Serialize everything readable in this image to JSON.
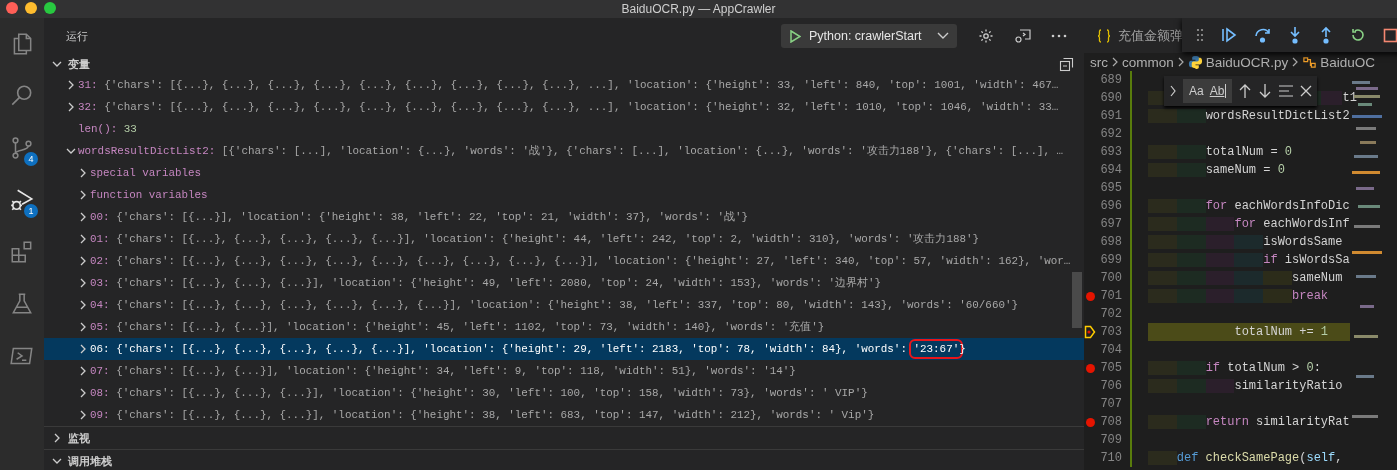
{
  "window": {
    "title": "BaiduOCR.py — AppCrawler"
  },
  "activity_bar": [
    {
      "kind": "files",
      "selected": false
    },
    {
      "kind": "search",
      "selected": false
    },
    {
      "kind": "scm",
      "selected": false,
      "badge": "4"
    },
    {
      "kind": "debug",
      "selected": true,
      "badge": "1"
    },
    {
      "kind": "extensions",
      "selected": false
    },
    {
      "kind": "testing",
      "selected": false
    },
    {
      "kind": "terminal",
      "selected": false
    }
  ],
  "run_panel": {
    "title": "运行",
    "config": "Python: crawlerStart"
  },
  "variables": {
    "title": "变量",
    "expanded": true,
    "nodes": [
      {
        "children": [
          {
            "kind": "item",
            "key": "31:",
            "expanded": false,
            "selected": false,
            "value": "{'chars': [{...}, {...}, {...}, {...}, {...}, {...}, {...}, {...}, {...}, ...], 'location': {'height': 33, 'left': 840, 'top': 1001, 'width': 467…"
          },
          {
            "kind": "item",
            "key": "32:",
            "expanded": false,
            "selected": false,
            "value": "{'chars': [{...}, {...}, {...}, {...}, {...}, {...}, {...}, {...}, {...}, ...], 'location': {'height': 32, 'left': 1010, 'top': 1046, 'width': 33…"
          },
          {
            "kind": "len",
            "key": "len():",
            "selected": false,
            "value": "33"
          }
        ]
      },
      {
        "kind": "item",
        "key": "wordsResultDictList2:",
        "expanded": true,
        "selected": false,
        "value": "[{'chars': [...], 'location': {...}, 'words': '战'}, {'chars': [...], 'location': {...}, 'words': '攻击力188'}, {'chars': [...], …",
        "children": [
          {
            "kind": "group",
            "key": "special variables",
            "expanded": false,
            "selected": false
          },
          {
            "kind": "group",
            "key": "function variables",
            "expanded": false,
            "selected": false
          },
          {
            "kind": "item",
            "key": "00:",
            "expanded": false,
            "selected": false,
            "value": "{'chars': [{...}], 'location': {'height': 38, 'left': 22, 'top': 21, 'width': 37}, 'words': '战'}"
          },
          {
            "kind": "item",
            "key": "01:",
            "expanded": false,
            "selected": false,
            "value": "{'chars': [{...}, {...}, {...}, {...}, {...}], 'location': {'height': 44, 'left': 242, 'top': 2, 'width': 310}, 'words': '攻击力188'}"
          },
          {
            "kind": "item",
            "key": "02:",
            "expanded": false,
            "selected": false,
            "value": "{'chars': [{...}, {...}, {...}, {...}, {...}, {...}, {...}, {...}, {...}], 'location': {'height': 27, 'left': 340, 'top': 57, 'width': 162}, 'wor…"
          },
          {
            "kind": "item",
            "key": "03:",
            "expanded": false,
            "selected": false,
            "value": "{'chars': [{...}, {...}, {...}], 'location': {'height': 49, 'left': 2080, 'top': 24, 'width': 153}, 'words': '边界村'}"
          },
          {
            "kind": "item",
            "key": "04:",
            "expanded": false,
            "selected": false,
            "value": "{'chars': [{...}, {...}, {...}, {...}, {...}, {...}], 'location': {'height': 38, 'left': 337, 'top': 80, 'width': 143}, 'words': '60/660'}"
          },
          {
            "kind": "item",
            "key": "05:",
            "expanded": false,
            "selected": false,
            "value": "{'chars': [{...}, {...}], 'location': {'height': 45, 'left': 1102, 'top': 73, 'width': 140}, 'words': '充值'}"
          },
          {
            "kind": "item",
            "key": "06:",
            "expanded": false,
            "selected": true,
            "value": "{'chars': [{...}, {...}, {...}, {...}, {...}], 'location': {'height': 29, 'left': 2183, 'top': 78, 'width': 84}, 'words': ",
            "boxed": "'23:67'",
            "value_end": "}"
          },
          {
            "kind": "item",
            "key": "07:",
            "expanded": false,
            "selected": false,
            "value": "{'chars': [{...}, {...}], 'location': {'height': 34, 'left': 9, 'top': 118, 'width': 51}, 'words': '14'}"
          },
          {
            "kind": "item",
            "key": "08:",
            "expanded": false,
            "selected": false,
            "value": "{'chars': [{...}, {...}, {...}], 'location': {'height': 30, 'left': 100, 'top': 158, 'width': 73}, 'words': ' VIP'}"
          },
          {
            "kind": "item",
            "key": "09:",
            "expanded": false,
            "selected": false,
            "value": "{'chars': [{...}, {...}, {...}], 'location': {'height': 38, 'left': 683, 'top': 147, 'width': 212}, 'words': ' Vip'}"
          }
        ]
      }
    ]
  },
  "sections": [
    {
      "title": "监视",
      "expanded": false
    },
    {
      "title": "调用堆栈",
      "expanded": true
    }
  ],
  "editor": {
    "tab": {
      "label": "充值金额弹"
    },
    "breadcrumb": [
      {
        "kind": "folder",
        "label": "src"
      },
      {
        "kind": "folder",
        "label": "common"
      },
      {
        "kind": "python",
        "label": "BaiduOCR.py"
      },
      {
        "kind": "symbol",
        "label": "BaiduOC"
      }
    ],
    "find_widget": {
      "options": [
        "Aa",
        "Ab"
      ]
    },
    "lines": [
      {
        "number": "689",
        "breakpoint": false,
        "current": false
      },
      {
        "number": "690",
        "breakpoint": false,
        "current": false,
        "tokens": [
          {
            "kind": "id",
            "text": "                           t1"
          }
        ]
      },
      {
        "number": "691",
        "breakpoint": false,
        "current": false,
        "tokens": [
          {
            "kind": "id",
            "text": "        wordsResultDictList2"
          }
        ]
      },
      {
        "number": "692",
        "breakpoint": false,
        "current": false
      },
      {
        "number": "693",
        "breakpoint": false,
        "current": false,
        "tokens": [
          {
            "kind": "id",
            "text": "        totalNum = "
          },
          {
            "kind": "num",
            "text": "0"
          }
        ]
      },
      {
        "number": "694",
        "breakpoint": false,
        "current": false,
        "tokens": [
          {
            "kind": "id",
            "text": "        sameNum = "
          },
          {
            "kind": "num",
            "text": "0"
          }
        ]
      },
      {
        "number": "695",
        "breakpoint": false,
        "current": false
      },
      {
        "number": "696",
        "breakpoint": false,
        "current": false,
        "tokens": [
          {
            "kind": "kw",
            "text": "        for"
          },
          {
            "kind": "id",
            "text": " eachWordsInfoDic"
          }
        ]
      },
      {
        "number": "697",
        "breakpoint": false,
        "current": false,
        "tokens": [
          {
            "kind": "kw",
            "text": "            for"
          },
          {
            "kind": "id",
            "text": " eachWordsInf"
          }
        ]
      },
      {
        "number": "698",
        "breakpoint": false,
        "current": false,
        "tokens": [
          {
            "kind": "id",
            "text": "                isWordsSame"
          }
        ]
      },
      {
        "number": "699",
        "breakpoint": false,
        "current": false,
        "tokens": [
          {
            "kind": "kw",
            "text": "                if"
          },
          {
            "kind": "id",
            "text": " isWordsSa"
          }
        ]
      },
      {
        "number": "700",
        "breakpoint": false,
        "current": false,
        "tokens": [
          {
            "kind": "id",
            "text": "                    sameNum"
          }
        ]
      },
      {
        "number": "701",
        "breakpoint": true,
        "current": false,
        "tokens": [
          {
            "kind": "kw",
            "text": "                    break"
          }
        ]
      },
      {
        "number": "702",
        "breakpoint": false,
        "current": false
      },
      {
        "number": "703",
        "breakpoint": false,
        "current": true,
        "tokens": [
          {
            "kind": "id",
            "text": "            totalNum += "
          },
          {
            "kind": "num",
            "text": "1"
          }
        ]
      },
      {
        "number": "704",
        "breakpoint": false,
        "current": false
      },
      {
        "number": "705",
        "breakpoint": true,
        "current": false,
        "tokens": [
          {
            "kind": "kw",
            "text": "        if"
          },
          {
            "kind": "id",
            "text": " totalNum > "
          },
          {
            "kind": "num",
            "text": "0"
          },
          {
            "kind": "id",
            "text": ":"
          }
        ]
      },
      {
        "number": "706",
        "breakpoint": false,
        "current": false,
        "tokens": [
          {
            "kind": "id",
            "text": "            similarityRatio"
          }
        ]
      },
      {
        "number": "707",
        "breakpoint": false,
        "current": false
      },
      {
        "number": "708",
        "breakpoint": true,
        "current": false,
        "tokens": [
          {
            "kind": "kw",
            "text": "        return"
          },
          {
            "kind": "id",
            "text": " similarityRat"
          }
        ]
      },
      {
        "number": "709",
        "breakpoint": false,
        "current": false
      },
      {
        "number": "710",
        "breakpoint": false,
        "current": false,
        "tokens": [
          {
            "kind": "def",
            "text": "    def"
          },
          {
            "kind": "fn",
            "text": " checkSamePage"
          },
          {
            "kind": "id",
            "text": "("
          },
          {
            "kind": "self",
            "text": "self"
          },
          {
            "kind": "id",
            "text": ","
          }
        ]
      }
    ]
  }
}
